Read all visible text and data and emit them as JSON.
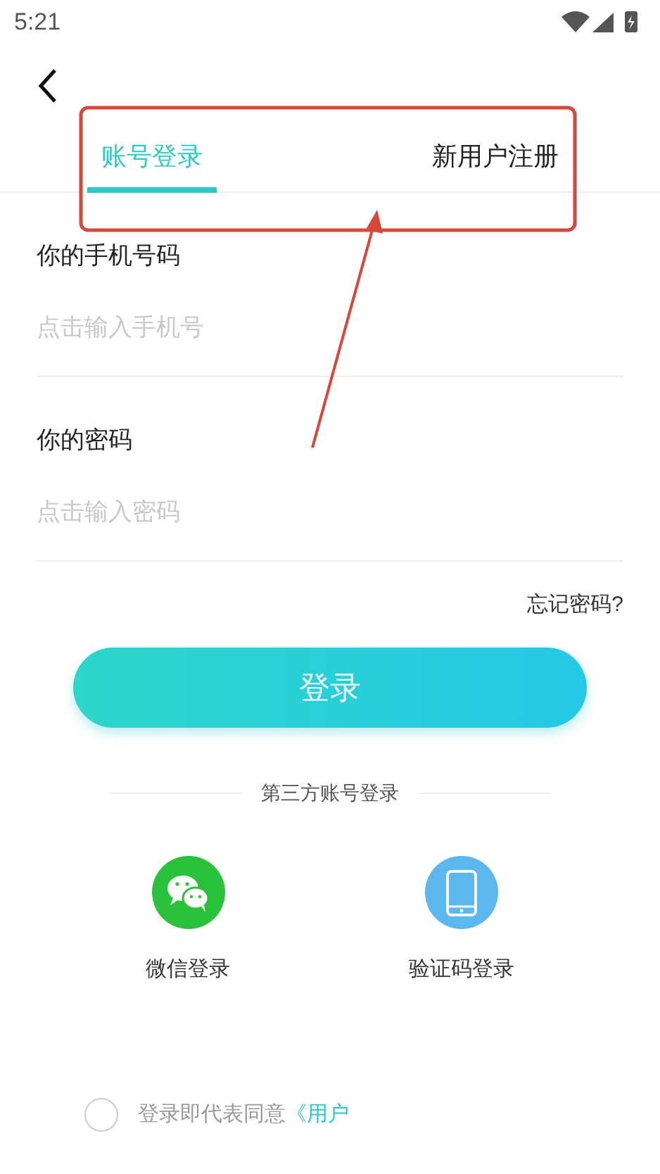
{
  "status_bar": {
    "time": "5:21"
  },
  "tabs": [
    {
      "label": "账号登录",
      "selected": true
    },
    {
      "label": "新用户注册",
      "selected": false
    }
  ],
  "fields": [
    {
      "label": "你的手机号码",
      "placeholder": "点击输入手机号"
    },
    {
      "label": "你的密码",
      "placeholder": "点击输入密码"
    }
  ],
  "forgot_link": "忘记密码?",
  "login_button": "登录",
  "third_party": {
    "title": "第三方账号登录",
    "options": [
      {
        "label": "微信登录",
        "kind": "wechat",
        "color": "#2bc23b"
      },
      {
        "label": "验证码登录",
        "kind": "phone",
        "color": "#5bb8ee"
      }
    ]
  },
  "agreement": {
    "checked": false,
    "text": "登录即代表同意",
    "link": "《用户"
  }
}
